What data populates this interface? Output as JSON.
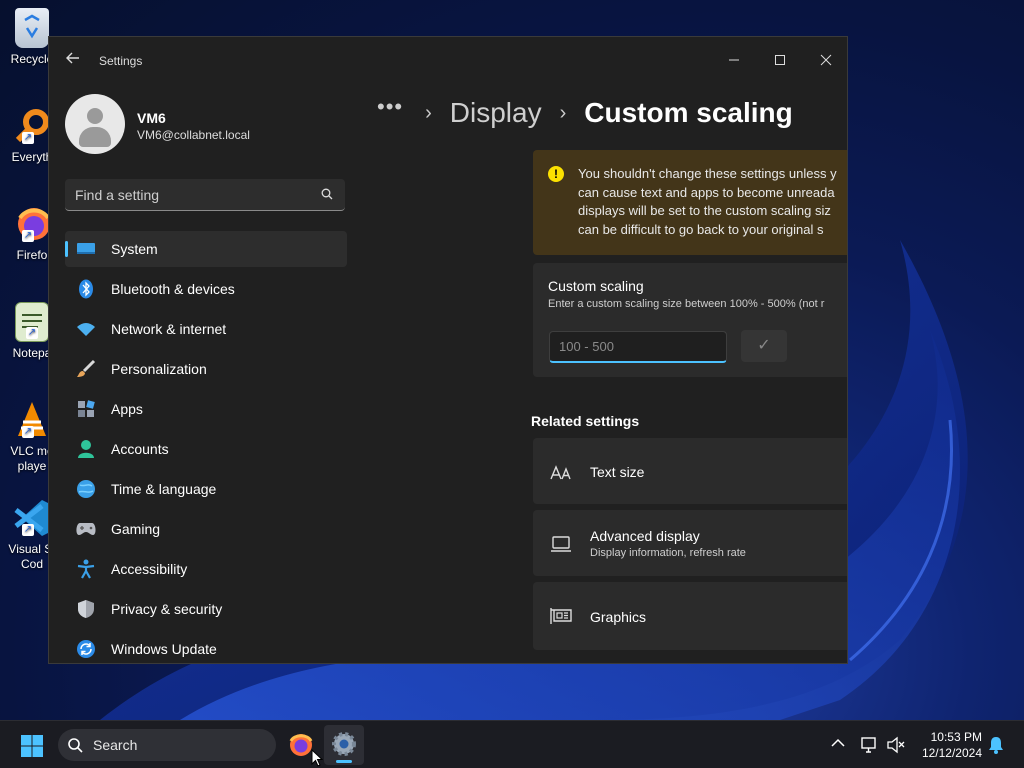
{
  "desktop": {
    "icons": [
      {
        "label": "Recycle",
        "icon": "recycle-bin-icon"
      },
      {
        "label": "Everyth",
        "icon": "everything-search-icon"
      },
      {
        "label": "Firefo",
        "icon": "firefox-icon"
      },
      {
        "label": "Notepa",
        "icon": "notepad-icon"
      },
      {
        "label": "VLC me",
        "label2": "playe",
        "icon": "vlc-icon"
      },
      {
        "label": "Visual St",
        "label2": "Cod",
        "icon": "vscode-icon"
      }
    ]
  },
  "window": {
    "app_title": "Settings",
    "controls": {
      "minimize": "—",
      "maximize": "☐",
      "close": "✕"
    }
  },
  "profile": {
    "name": "VM6",
    "email": "VM6@collabnet.local"
  },
  "search": {
    "placeholder": "Find a setting"
  },
  "nav": {
    "items": [
      {
        "label": "System",
        "icon": "system-icon",
        "active": true
      },
      {
        "label": "Bluetooth & devices",
        "icon": "bluetooth-icon"
      },
      {
        "label": "Network & internet",
        "icon": "wifi-icon"
      },
      {
        "label": "Personalization",
        "icon": "brush-icon"
      },
      {
        "label": "Apps",
        "icon": "apps-icon"
      },
      {
        "label": "Accounts",
        "icon": "accounts-icon"
      },
      {
        "label": "Time & language",
        "icon": "globe-clock-icon"
      },
      {
        "label": "Gaming",
        "icon": "gamepad-icon"
      },
      {
        "label": "Accessibility",
        "icon": "accessibility-icon"
      },
      {
        "label": "Privacy & security",
        "icon": "shield-icon"
      },
      {
        "label": "Windows Update",
        "icon": "update-icon"
      }
    ]
  },
  "breadcrumb": {
    "more": "•••",
    "separator": "›",
    "parent": "Display",
    "current": "Custom scaling"
  },
  "warning": {
    "icon": "!",
    "lines": [
      "You shouldn't change these settings unless y",
      "can cause text and apps to become unreada",
      "displays will be set to the custom scaling siz",
      "can be difficult to go back to your original s"
    ]
  },
  "custom_scaling": {
    "title": "Custom scaling",
    "description": "Enter a custom scaling size between 100% - 500% (not r",
    "input_placeholder": "100 - 500",
    "apply_label": "✓"
  },
  "related": {
    "title": "Related settings",
    "items": [
      {
        "title": "Text size",
        "subtitle": "",
        "icon": "text-size-icon"
      },
      {
        "title": "Advanced display",
        "subtitle": "Display information, refresh rate",
        "icon": "laptop-icon"
      },
      {
        "title": "Graphics",
        "subtitle": "",
        "icon": "graphics-card-icon"
      }
    ]
  },
  "taskbar": {
    "search_label": "Search",
    "time": "10:53 PM",
    "date": "12/12/2024",
    "tray_chevron": "^"
  },
  "colors": {
    "accent": "#4cc2ff",
    "warning_bg": "#433519",
    "warning_icon": "#fce100",
    "window_bg": "#202020",
    "card_bg": "#2b2b2b"
  }
}
